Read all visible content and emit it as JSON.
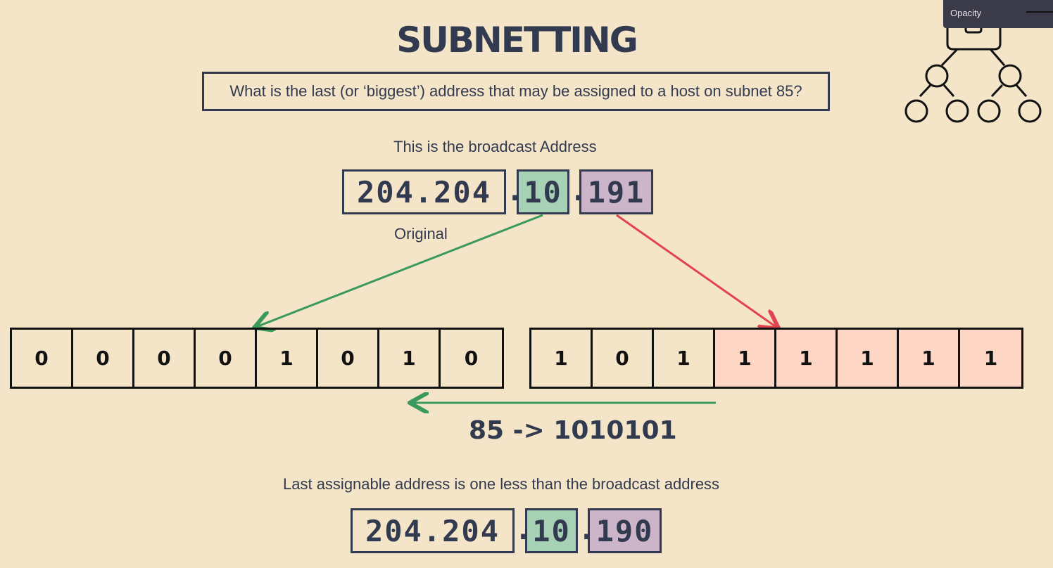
{
  "title": "SUBNETTING",
  "question": "What is the last (or ‘biggest’) address that may be assigned to a host on subnet 85?",
  "broadcast_caption": "This is the broadcast Address",
  "broadcast_ip": {
    "fixed": "204.204",
    "third": "10",
    "fourth": "191",
    "sep1": ".",
    "sep2": "."
  },
  "original_label": "Original",
  "third_octet_bits": [
    "0",
    "0",
    "0",
    "0",
    "1",
    "0",
    "1",
    "0"
  ],
  "fourth_octet_bits": [
    "1",
    "0",
    "1",
    "1",
    "1",
    "1",
    "1",
    "1"
  ],
  "conversion": "85 -> 1010101",
  "last_caption": "Last assignable address is one less than the broadcast address",
  "last_ip": {
    "fixed": "204.204",
    "third": "10",
    "fourth": "190",
    "sep1": ".",
    "sep2": "."
  },
  "opacity_panel": {
    "label": "Opacity"
  },
  "colors": {
    "background": "#f5e5c8",
    "text": "#323a4f",
    "green": "#a6d1b5",
    "purple": "#cdb5c9",
    "highlight": "#fdd6c6",
    "arrow_green": "#3a9a5e",
    "arrow_red": "#e0454f"
  }
}
